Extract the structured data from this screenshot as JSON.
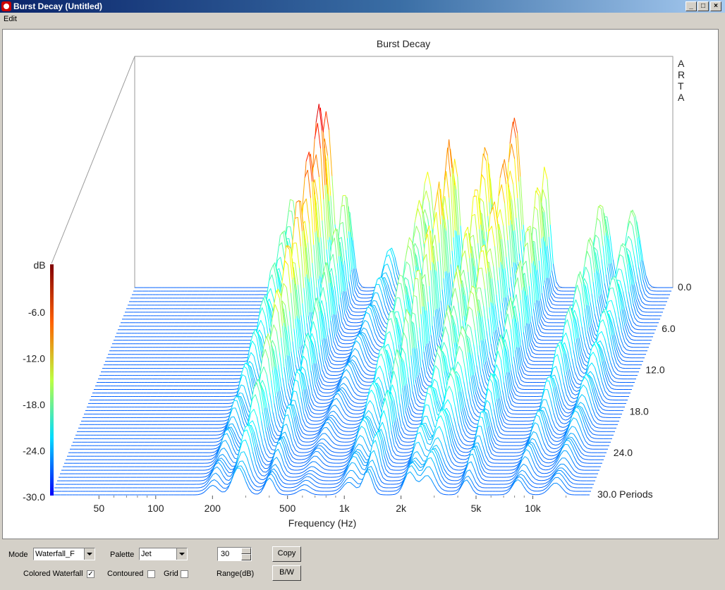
{
  "window": {
    "title": "Burst Decay  (Untitled)"
  },
  "menu": {
    "edit": "Edit"
  },
  "chart_data": {
    "type": "waterfall",
    "title": "Burst Decay",
    "watermark": "ARTA",
    "xlabel": "Frequency (Hz)",
    "x_ticks": [
      "50",
      "100",
      "200",
      "500",
      "1k",
      "2k",
      "5k",
      "10k"
    ],
    "x_scale": "log",
    "z_label": "Periods",
    "z_ticks": [
      "0.0",
      "6.0",
      "12.0",
      "18.0",
      "24.0",
      "30.0 Periods"
    ],
    "z_range": [
      0,
      30
    ],
    "colorbar_label": "dB",
    "colorbar_ticks": [
      "-6.0",
      "-12.0",
      "-18.0",
      "-24.0",
      "-30.0"
    ],
    "db_range": [
      -30,
      0
    ],
    "palette": "Jet",
    "peaks": [
      {
        "f": 115,
        "amp": 0.06
      },
      {
        "f": 190,
        "amp": 0.42
      },
      {
        "f": 290,
        "amp": 1.0
      },
      {
        "f": 380,
        "amp": 0.52
      },
      {
        "f": 640,
        "amp": 0.2
      },
      {
        "f": 1000,
        "amp": 0.55
      },
      {
        "f": 1400,
        "amp": 0.8
      },
      {
        "f": 2100,
        "amp": 0.72
      },
      {
        "f": 2900,
        "amp": 0.8
      },
      {
        "f": 4200,
        "amp": 0.62
      },
      {
        "f": 8800,
        "amp": 0.48
      },
      {
        "f": 12500,
        "amp": 0.4
      }
    ]
  },
  "controls": {
    "mode_label": "Mode",
    "mode_value": "Waterfall_F",
    "palette_label": "Palette",
    "palette_value": "Jet",
    "range_value": "30",
    "range_label": "Range(dB)",
    "copy_label": "Copy",
    "bw_label": "B/W",
    "colored_waterfall_label": "Colored Waterfall",
    "colored_waterfall_checked": true,
    "contoured_label": "Contoured",
    "contoured_checked": false,
    "grid_label": "Grid",
    "grid_checked": false
  }
}
